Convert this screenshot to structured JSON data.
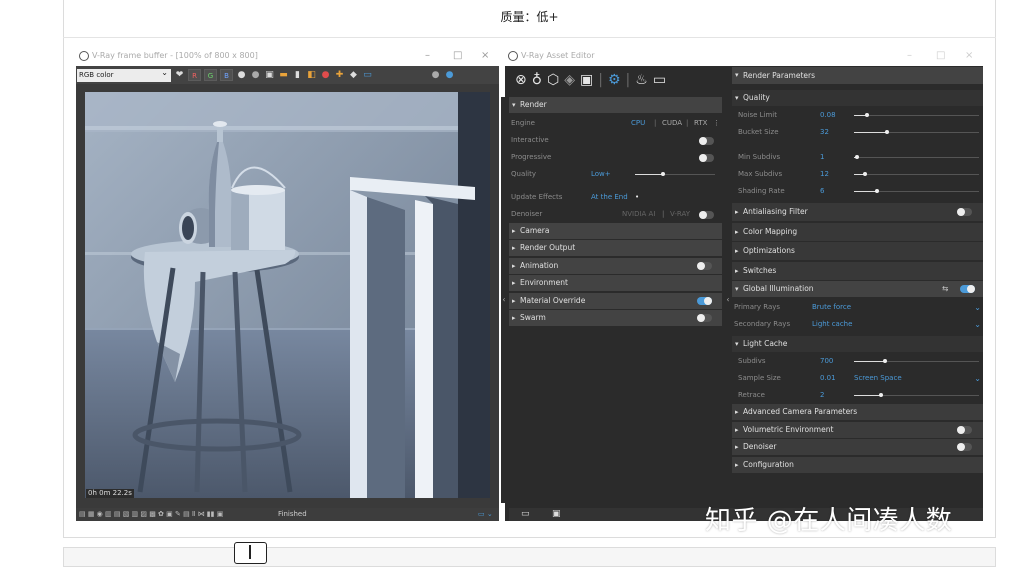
{
  "caption": "质量：低+",
  "vfb": {
    "title": "V-Ray frame buffer - [100% of 800 x 800]",
    "channel_select": "RGB color",
    "channels": [
      "R",
      "G",
      "B"
    ],
    "render_time": "0h 0m 22.2s",
    "status": "Finished"
  },
  "asset_editor": {
    "title": "V-Ray Asset Editor",
    "render_section": "Render",
    "engine_label": "Engine",
    "engines": [
      "CPU",
      "CUDA",
      "RTX"
    ],
    "interactive_label": "Interactive",
    "progressive_label": "Progressive",
    "quality_label": "Quality",
    "quality_value": "Low+",
    "quality_level": 0.35,
    "update_effects_label": "Update Effects",
    "update_effects_value": "At the End",
    "denoiser_label": "Denoiser",
    "denoiser_options": [
      "NVIDIA AI",
      "V-RAY"
    ],
    "sections": [
      {
        "label": "Camera",
        "toggle": null
      },
      {
        "label": "Render Output",
        "toggle": null
      },
      {
        "label": "Animation",
        "toggle": "off"
      },
      {
        "label": "Environment",
        "toggle": null
      },
      {
        "label": "Material Override",
        "toggle": "on"
      },
      {
        "label": "Swarm",
        "toggle": "off"
      }
    ]
  },
  "render_parameters": {
    "header": "Render Parameters",
    "quality_section": "Quality",
    "noise_limit_label": "Noise Limit",
    "noise_limit": "0.08",
    "bucket_size_label": "Bucket Size",
    "bucket_size": "32",
    "min_subdivs_label": "Min Subdivs",
    "min_subdivs": "1",
    "max_subdivs_label": "Max Subdivs",
    "max_subdivs": "12",
    "shading_rate_label": "Shading Rate",
    "shading_rate": "6",
    "antialiasing": "Antialiasing Filter",
    "color_mapping": "Color Mapping",
    "optimizations": "Optimizations",
    "switches": "Switches",
    "gi": "Global Illumination",
    "primary_rays_label": "Primary Rays",
    "primary_rays": "Brute force",
    "secondary_rays_label": "Secondary Rays",
    "secondary_rays": "Light cache",
    "light_cache": "Light Cache",
    "subdivs_label": "Subdivs",
    "subdivs": "700",
    "sample_size_label": "Sample Size",
    "sample_size": "0.01",
    "sample_space": "Screen Space",
    "retrace_label": "Retrace",
    "retrace": "2",
    "advanced_camera": "Advanced Camera Parameters",
    "volumetric": "Volumetric Environment",
    "denoiser": "Denoiser",
    "configuration": "Configuration"
  },
  "watermark": "知乎 @在人间凑人数",
  "colors": {
    "accent": "#4b9ad8",
    "panel": "#2b2b2b",
    "section": "#434343"
  }
}
